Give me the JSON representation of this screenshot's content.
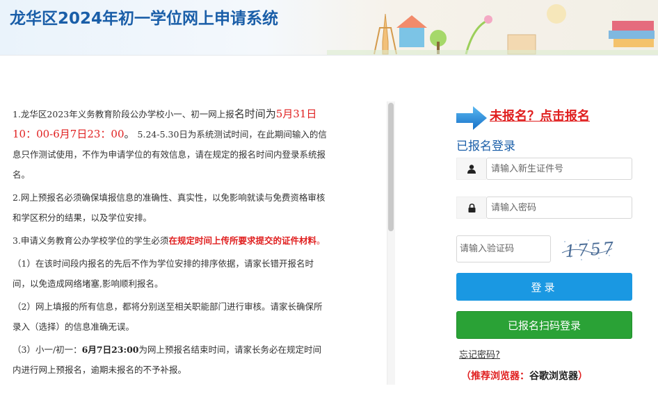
{
  "header": {
    "title": "龙华区2024年初一学位网上申请系统"
  },
  "notice": {
    "item1_a": "1.龙华区2023年义务教育阶段公办学校小一、初一网上报",
    "item1_b": "名时间为",
    "item1_c": "5月31日10：00-6月7日23：00",
    "item1_d": "。",
    "item1_e": "5.24-5.30日为系统测试时间，在此期间输入的信息只作测试使用，不作为申请学位的有效信息，请在规定的报名时间内登录系统报名。",
    "item2": "2.网上预报名必须确保填报信息的准确性、真实性，以免影响就读与免费资格审核和学区积分的结果，以及学位安排。",
    "item3_a": "3.申请义务教育公办学校学位的学生必须",
    "item3_b": "在规定时间上传所要求提交的证件材料",
    "item3_c": "。",
    "sub1": "（1）在该时间段内报名的先后不作为学位安排的排序依据，请家长错开报名时间，以免造成网络堵塞,影响顺利报名。",
    "sub2": "（2）网上填报的所有信息，都将分别送至相关职能部门进行审核。请家长确保所录入（选择）的信息准确无误。",
    "sub3_a": "（3）小一/初一：",
    "sub3_b": "6月7日23:00",
    "sub3_c": "为网上预报名结束时间，请家长务必在规定时间内进行网上预报名，逾期未报名的不予补报。"
  },
  "login": {
    "register_link": "未报名？点击报名",
    "heading": "已报名登录",
    "id_placeholder": "请输入新生证件号",
    "password_placeholder": "请输入密码",
    "captcha_placeholder": "请输入验证码",
    "captcha_code": "1757",
    "login_button": "登录",
    "scan_button": "已报名扫码登录",
    "forgot_link": "忘记密码?",
    "browser_note_prefix": "（推荐浏览器：",
    "browser_note_name": "谷歌浏览器",
    "browser_note_suffix": "）"
  },
  "icons": {
    "user": "user-icon",
    "lock": "lock-icon",
    "arrow": "arrow-right-icon"
  },
  "colors": {
    "title_blue": "#1a5ea8",
    "alert_red": "#e02020",
    "login_blue": "#1a98e2",
    "scan_green": "#2aa236"
  }
}
